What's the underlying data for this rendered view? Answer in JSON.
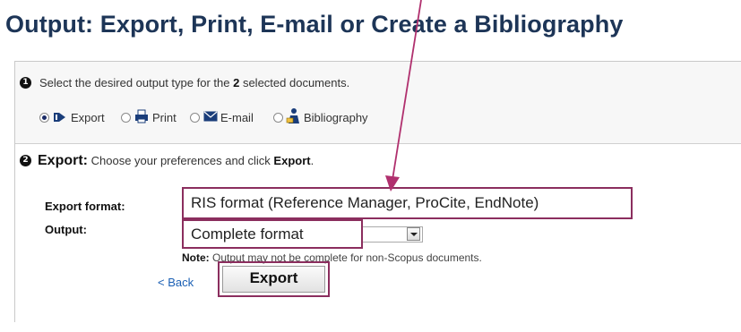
{
  "title": "Output: Export, Print, E-mail or Create a Bibliography",
  "step1": {
    "number": "1",
    "text_before": "Select the desired output type for the",
    "count": "2",
    "text_after": "selected documents.",
    "options": [
      {
        "label": "Export",
        "selected": true,
        "icon": "export-icon"
      },
      {
        "label": "Print",
        "selected": false,
        "icon": "printer-icon"
      },
      {
        "label": "E-mail",
        "selected": false,
        "icon": "envelope-icon"
      },
      {
        "label": "Bibliography",
        "selected": false,
        "icon": "bibliography-icon"
      }
    ]
  },
  "step2": {
    "number": "2",
    "heading": "Export:",
    "text_before": "Choose your preferences and click",
    "text_bold": "Export",
    "text_after": ".",
    "export_format_label": "Export format:",
    "export_format_value": "RIS format (Reference Manager, ProCite, EndNote)",
    "output_label": "Output:",
    "output_value": "Complete format",
    "note_label": "Note:",
    "note_text": "Output may not be complete for non-Scopus documents.",
    "back_label": "< Back",
    "export_button": "Export"
  },
  "colors": {
    "highlight_border": "#8b2e5e",
    "annotation_arrow": "#b0306e",
    "title": "#1d3557",
    "link": "#1a5fb4"
  }
}
